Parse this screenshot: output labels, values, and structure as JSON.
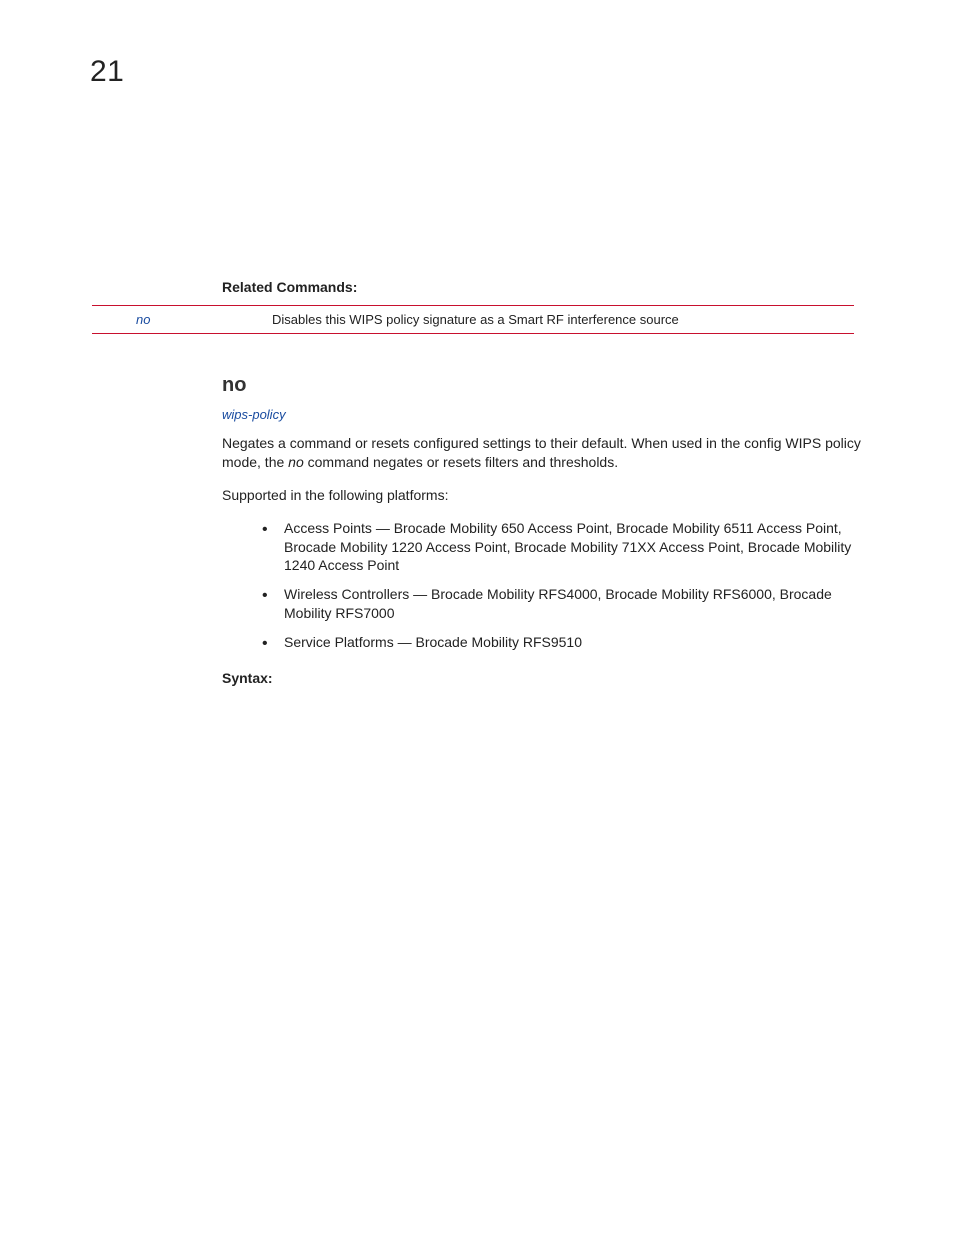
{
  "page_number": "21",
  "related_commands": {
    "title": "Related Commands:",
    "rows": [
      {
        "cmd": "no",
        "desc": "Disables this WIPS policy signature as a Smart RF interference source"
      }
    ]
  },
  "section": {
    "heading": "no",
    "breadcrumb": "wips-policy",
    "para1_a": "Negates a command or resets configured settings to their default. When used in the config WIPS policy mode, the ",
    "para1_no": "no",
    "para1_b": " command negates or resets filters and thresholds.",
    "supported_intro": "Supported in the following platforms:",
    "platforms": [
      "Access Points — Brocade Mobility 650 Access Point, Brocade Mobility 6511 Access Point, Brocade Mobility 1220 Access Point, Brocade Mobility 71XX Access Point, Brocade Mobility 1240 Access Point",
      "Wireless Controllers — Brocade Mobility RFS4000, Brocade Mobility RFS6000, Brocade Mobility RFS7000",
      "Service Platforms — Brocade Mobility RFS9510"
    ],
    "syntax_title": "Syntax:"
  }
}
